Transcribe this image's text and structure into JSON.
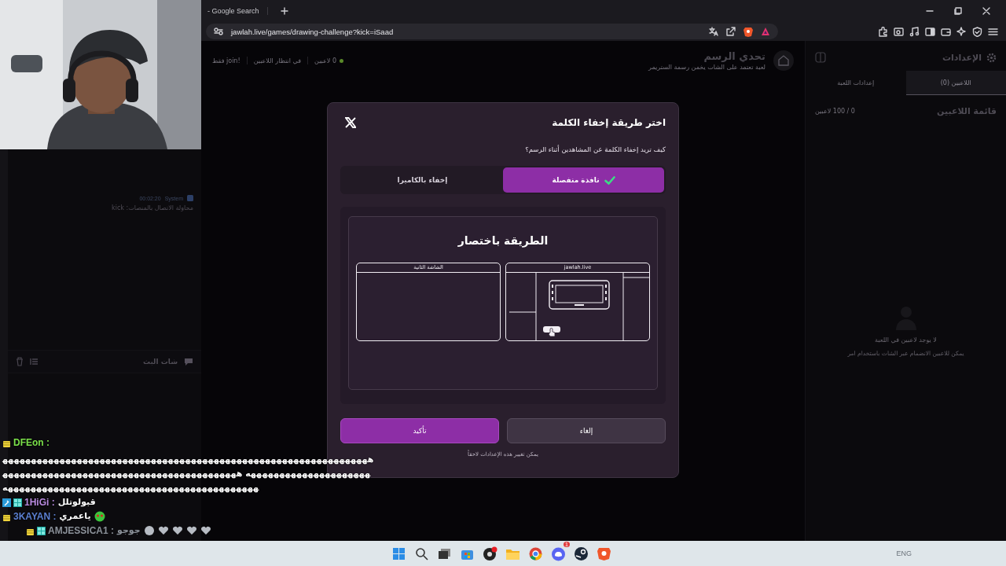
{
  "browser": {
    "tab_title": "- Google Search",
    "url": "jawlah.live/games/drawing-challenge?kick=iSaad"
  },
  "left_panel": {
    "log": {
      "time": "00:02:20",
      "sender": "System",
      "message": "محاولة الاتصال بالمنصات: kick"
    },
    "chat_title": "شات البث"
  },
  "header": {
    "title": "تحدي الرسم",
    "subtitle": "لعبة تعتمد على الشات يخمن رسمة الستريمر",
    "status": [
      {
        "text": "0 لاعبين",
        "color": "#5a8a2a"
      },
      {
        "text": "في انتظار اللاعبين"
      },
      {
        "text": "!join فقط"
      }
    ]
  },
  "sidebar": {
    "title": "الإعدادات",
    "tabs": [
      {
        "label": "اللاعبين (0)",
        "selected": true
      },
      {
        "label": "إعدادات اللعبة",
        "selected": false
      }
    ],
    "list_title": "قائمة اللاعبين",
    "count": "0 / 100 لاعبين",
    "empty_title": "لا يوجد لاعبين في اللعبة",
    "empty_hint": "يمكن للاعبين الانضمام عبر الشات باستخدام امر"
  },
  "modal": {
    "title": "اختر طريقة إخفاء الكلمة",
    "question": "كيف تريد إخفاء الكلمة عن المشاهدين أثناء الرسم؟",
    "options": [
      {
        "label": "نافذة منفصلة",
        "selected": true
      },
      {
        "label": "إخفاء بالكاميرا",
        "selected": false
      }
    ],
    "preview": {
      "title": "الطريقة باختصار",
      "screens": [
        {
          "label": "jawlah.live",
          "kind": "main"
        },
        {
          "label": "الشاشة الثانية",
          "kind": "blank"
        }
      ]
    },
    "buttons": [
      {
        "label": "إلغاء",
        "kind": "secondary"
      },
      {
        "label": "تأكيد",
        "kind": "primary"
      }
    ],
    "note": "يمكن تغيير هذه الإعدادات لاحقاً"
  },
  "stream_chat": [
    {
      "user": "DFEon :",
      "color": "#7be04a",
      "badges": [
        {
          "kind": "crown"
        }
      ],
      "text": "ههههههههههههههههههههههههههههههههههههههههههههههههههههههههههههههههههههههههههههههههههههههه ههههههههههههههههههههههههههههههههههههههههههههههههههههههههههههههههههههههههههههههههههههههه",
      "faded": false
    },
    {
      "user": "1HiGi :",
      "color": "#b98be0",
      "badges": [
        {
          "kind": "tool"
        },
        {
          "kind": "grid"
        }
      ],
      "text": "قبولوتلل",
      "faded": false
    },
    {
      "user": "3KAYAN :",
      "color": "#5b7fd0",
      "badges": [
        {
          "kind": "crown"
        }
      ],
      "text": "ياعمري",
      "emotes": [
        {
          "kind": "smiley"
        }
      ],
      "faded": false
    },
    {
      "user": "AMJESSICA1 :",
      "color": "#8a9098",
      "badges": [
        {
          "kind": "crown"
        },
        {
          "kind": "grid"
        }
      ],
      "text": "جوجو",
      "emotes": [
        {
          "kind": "dot"
        },
        {
          "kind": "heart"
        },
        {
          "kind": "heart"
        },
        {
          "kind": "heart"
        },
        {
          "kind": "heart"
        }
      ],
      "faded": true
    }
  ],
  "taskbar": {
    "discord_badge": "1",
    "language": "ENG"
  }
}
